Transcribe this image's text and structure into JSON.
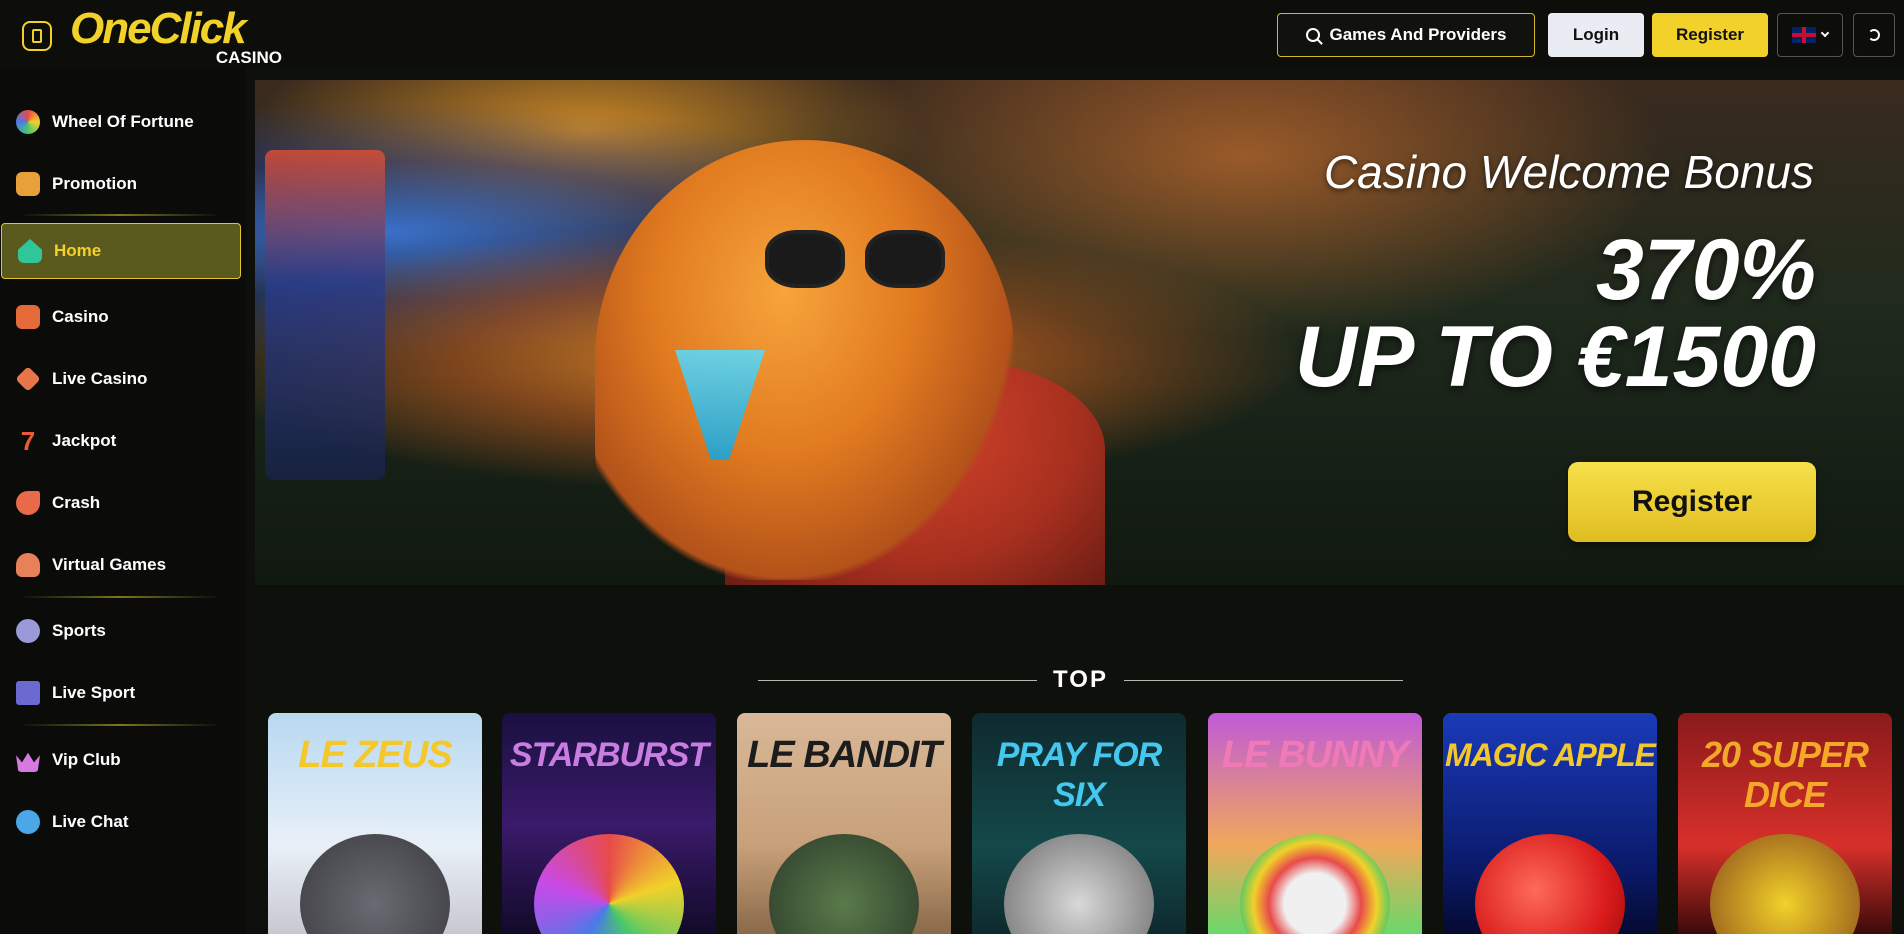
{
  "header": {
    "logo_brand": "OneClick",
    "logo_sub": "CASINO",
    "search_label": "Games And Providers",
    "login_label": "Login",
    "register_label": "Register"
  },
  "sidebar": {
    "items": [
      {
        "label": "Wheel Of Fortune",
        "icon": "wheel-icon"
      },
      {
        "label": "Promotion",
        "icon": "gift-icon"
      },
      {
        "label": "Home",
        "icon": "home-icon",
        "active": true
      },
      {
        "label": "Casino",
        "icon": "slot-machine-icon"
      },
      {
        "label": "Live Casino",
        "icon": "cards-icon"
      },
      {
        "label": "Jackpot",
        "icon": "seven-icon"
      },
      {
        "label": "Crash",
        "icon": "rocket-icon"
      },
      {
        "label": "Virtual Games",
        "icon": "gamer-icon"
      },
      {
        "label": "Sports",
        "icon": "soccer-ball-icon"
      },
      {
        "label": "Live Sport",
        "icon": "monitor-icon"
      },
      {
        "label": "Vip Club",
        "icon": "crown-icon"
      },
      {
        "label": "Live Chat",
        "icon": "chat-icon"
      }
    ]
  },
  "banner": {
    "title": "Casino Welcome Bonus",
    "percent": "370%",
    "amount": "UP TO €1500",
    "register_label": "Register"
  },
  "top_section": {
    "title": "TOP",
    "games": [
      {
        "title": "LE ZEUS",
        "color": "#f4c82a"
      },
      {
        "title": "STARBURST",
        "color": "#c87ee0"
      },
      {
        "title": "LE BANDIT",
        "color": "#1c1c1c"
      },
      {
        "title": "PRAY FOR SIX",
        "color": "#44c8f0"
      },
      {
        "title": "LE BUNNY",
        "color": "#f07ab8"
      },
      {
        "title": "MAGIC APPLE",
        "color": "#f4c82a"
      },
      {
        "title": "20 SUPER DICE",
        "color": "#f4a82a"
      }
    ]
  }
}
